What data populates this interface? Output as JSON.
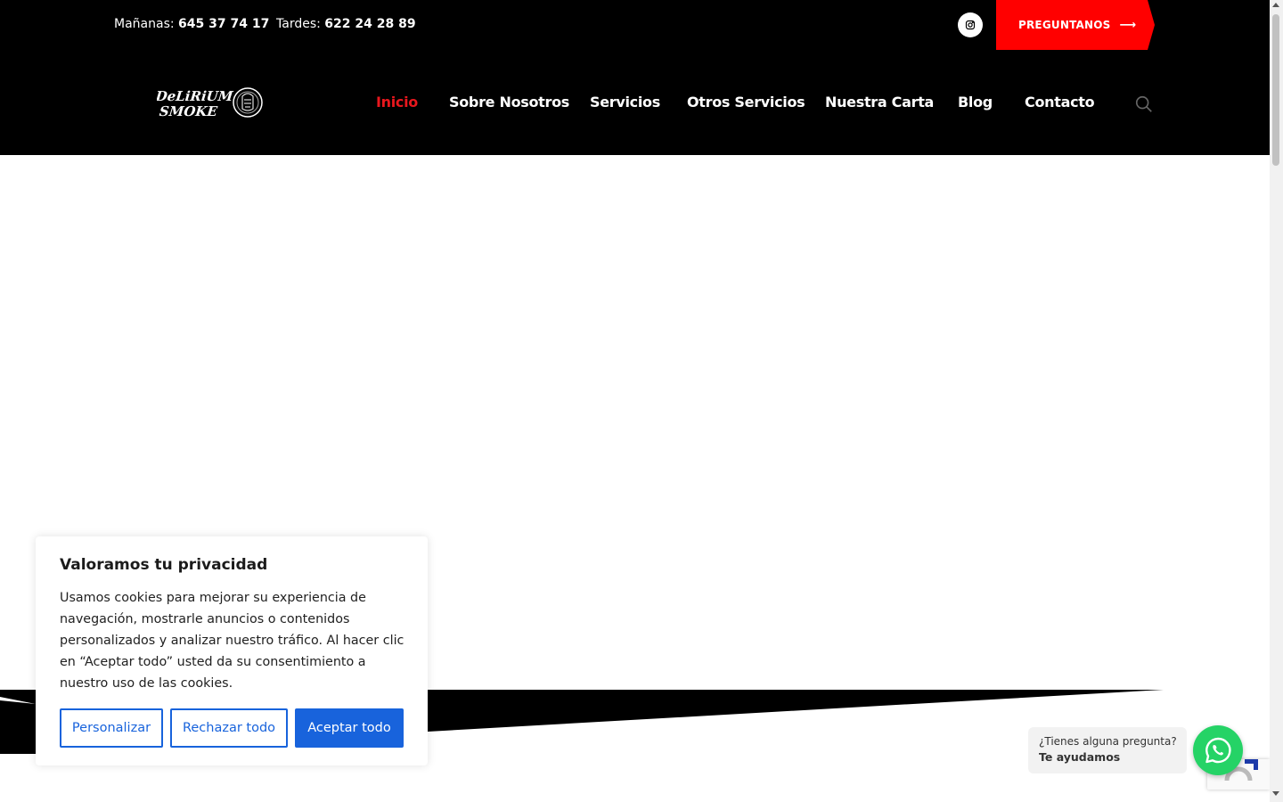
{
  "topbar": {
    "phone_morning_label": "Mañanas:",
    "phone_morning_number": "645 37 74 17",
    "phone_afternoon_label": "Tardes:",
    "phone_afternoon_number": "622 24 28 89",
    "social_icon": "instagram-icon",
    "cta_label": "PREGUNTANOS",
    "cta_icon": "arrow-right-icon",
    "cta_color": "#ff0000"
  },
  "header": {
    "logo_line1": "DeLiRiUM",
    "logo_line2": "SMOKE",
    "nav": [
      {
        "label": "Inicio",
        "active": true
      },
      {
        "label": "Sobre Nosotros",
        "active": false
      },
      {
        "label": "Servicios",
        "active": false
      },
      {
        "label": "Otros Servicios",
        "active": false
      },
      {
        "label": "Nuestra Carta",
        "active": false
      },
      {
        "label": "Blog",
        "active": false
      },
      {
        "label": "Contacto",
        "active": false
      }
    ],
    "search_icon": "search-icon",
    "active_color": "#e8171d"
  },
  "cookie_banner": {
    "title": "Valoramos tu privacidad",
    "text": "Usamos cookies para mejorar su experiencia de navegación, mostrarle anuncios o contenidos personalizados y analizar nuestro tráfico. Al hacer clic en “Aceptar todo” usted da su consentimiento a nuestro uso de las cookies.",
    "customize_label": "Personalizar",
    "reject_label": "Rechazar todo",
    "accept_label": "Aceptar todo",
    "accent_color": "#1863dc"
  },
  "whatsapp": {
    "question": "¿Tienes alguna pregunta?",
    "answer": "Te ayudamos",
    "icon": "whatsapp-icon",
    "color": "#25d366"
  },
  "recaptcha": {
    "icon": "recaptcha-icon"
  }
}
